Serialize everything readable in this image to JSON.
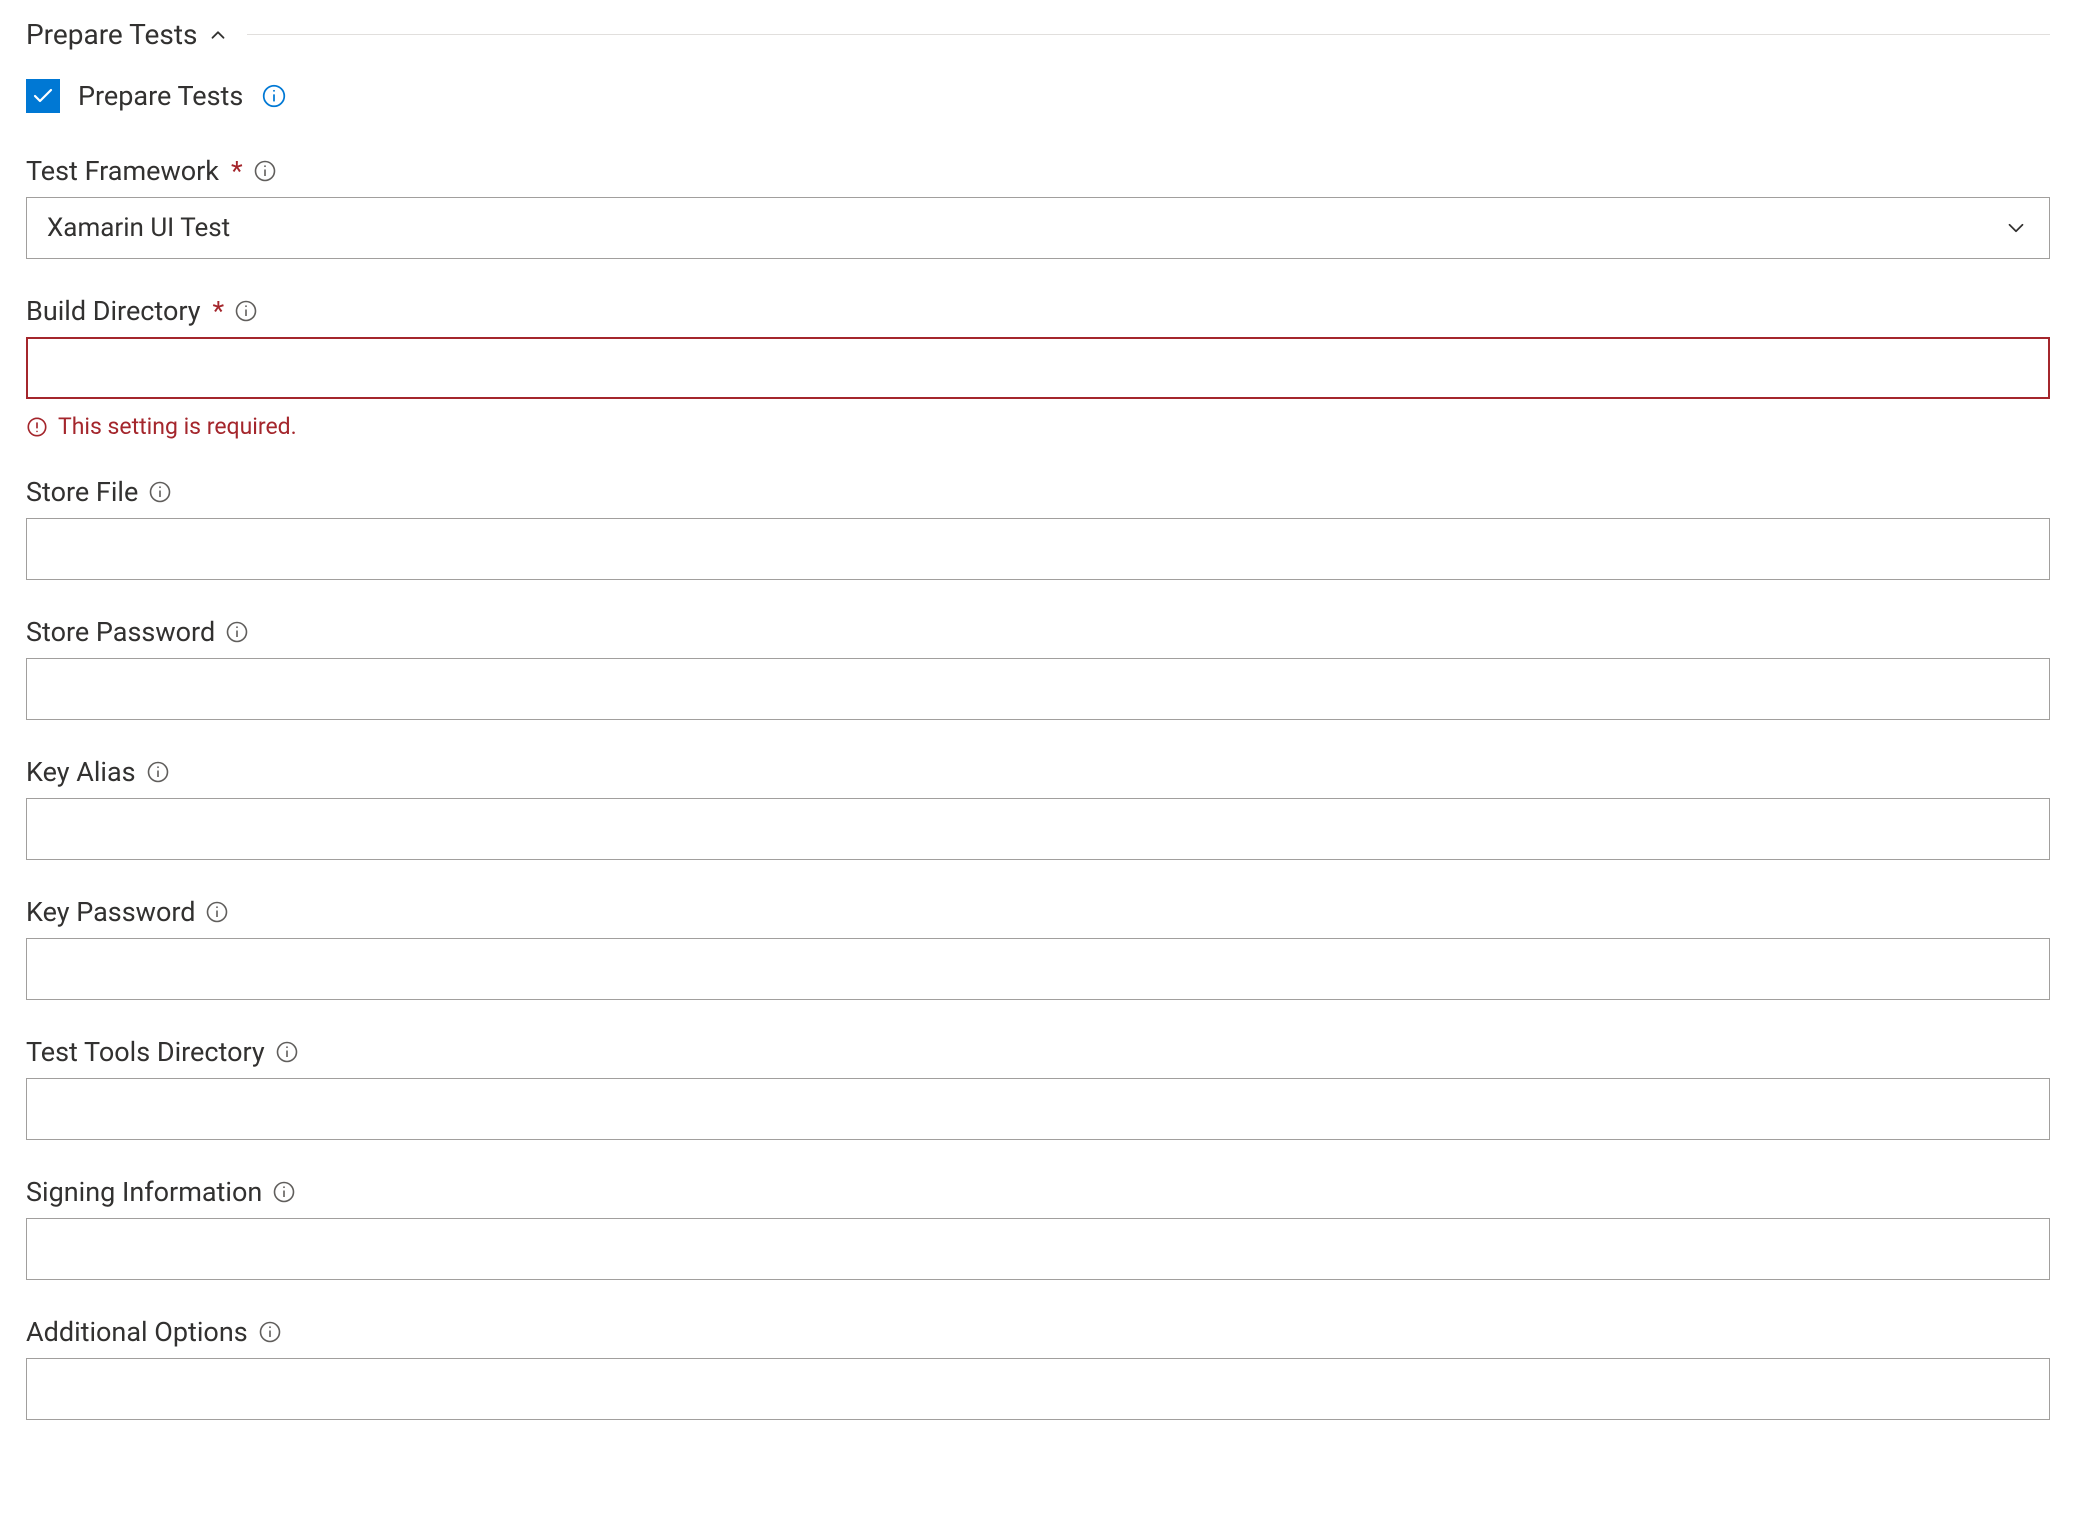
{
  "section": {
    "title": "Prepare Tests"
  },
  "prepare_checkbox": {
    "label": "Prepare Tests",
    "checked": true
  },
  "fields": {
    "test_framework": {
      "label": "Test Framework",
      "required": true,
      "value": "Xamarin UI Test"
    },
    "build_directory": {
      "label": "Build Directory",
      "required": true,
      "value": "",
      "error": "This setting is required."
    },
    "store_file": {
      "label": "Store File",
      "value": ""
    },
    "store_password": {
      "label": "Store Password",
      "value": ""
    },
    "key_alias": {
      "label": "Key Alias",
      "value": ""
    },
    "key_password": {
      "label": "Key Password",
      "value": ""
    },
    "test_tools_directory": {
      "label": "Test Tools Directory",
      "value": ""
    },
    "signing_information": {
      "label": "Signing Information",
      "value": ""
    },
    "additional_options": {
      "label": "Additional Options",
      "value": ""
    }
  }
}
